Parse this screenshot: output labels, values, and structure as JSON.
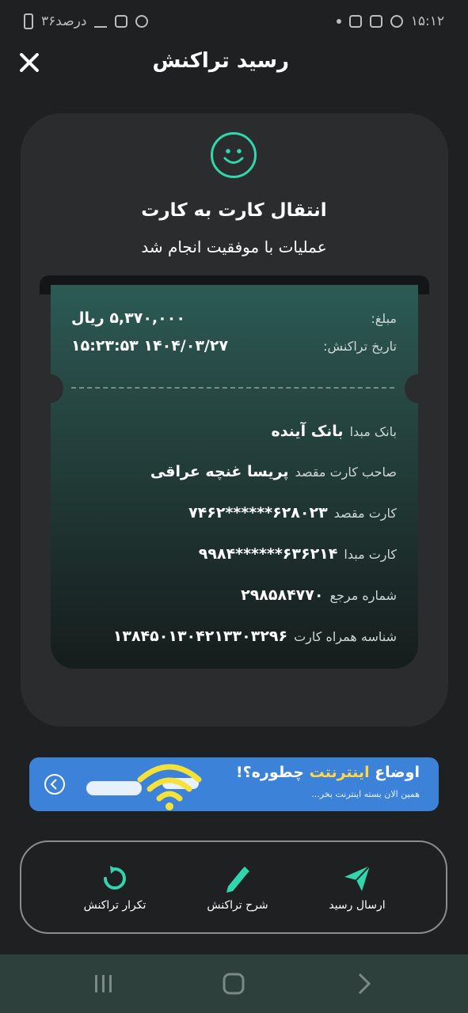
{
  "status_bar": {
    "time": "۱۵:۱۲",
    "battery": "۳۶درصد"
  },
  "header": {
    "title": "رسید تراکنش"
  },
  "transaction": {
    "type": "انتقال کارت به کارت",
    "status": "عملیات با موفقیت انجام شد",
    "amount_label": "مبلغ:",
    "amount_value": "۵,۳۷۰,۰۰۰ ریال",
    "date_label": "تاریخ تراکنش:",
    "date_value": "۱۴۰۴/۰۳/۲۷ ۱۵:۲۳:۵۳",
    "source_bank_label": "بانک مبدا",
    "source_bank_value": "بانک آینده",
    "dest_owner_label": "صاحب کارت مقصد",
    "dest_owner_value": "پریسا غنچه عراقی",
    "dest_card_label": "کارت مقصد",
    "dest_card_value": "۶۲۸۰۲۳******۷۴۶۲",
    "source_card_label": "کارت مبدا",
    "source_card_value": "۶۳۶۲۱۴******۹۹۸۴",
    "reference_label": "شماره مرجع",
    "reference_value": "۲۹۸۵۸۴۷۷۰",
    "mobile_card_id_label": "شناسه همراه کارت",
    "mobile_card_id_value": "۱۳۸۴۵۰۱۳۰۴۲۱۳۳۰۳۲۹۶"
  },
  "banner": {
    "title_prefix": "اوضاع ",
    "title_highlight": "اینترنتت",
    "title_suffix": " چطوره؟!",
    "subtitle": "همین الان بسته اینترنت بخر..."
  },
  "actions": {
    "send_receipt": "ارسال رسید",
    "describe": "شرح تراکنش",
    "repeat": "تکرار تراکنش"
  },
  "colors": {
    "accent": "#32d6ad",
    "background": "#1f2021",
    "card": "#2b2c2e",
    "banner": "#3c82d8"
  }
}
